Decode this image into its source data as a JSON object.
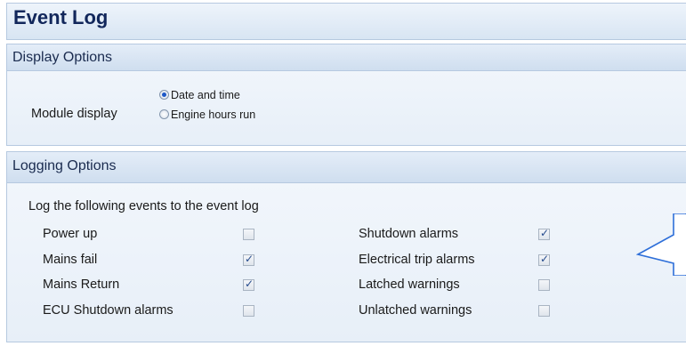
{
  "page_title": "Event Log",
  "display_options": {
    "header": "Display Options",
    "module_display_label": "Module display",
    "options": [
      {
        "label": "Date and time",
        "selected": true
      },
      {
        "label": "Engine hours run",
        "selected": false
      }
    ]
  },
  "logging_options": {
    "header": "Logging Options",
    "intro": "Log the following events to the event log",
    "left_events": [
      {
        "label": "Power up",
        "checked": false
      },
      {
        "label": "Mains fail",
        "checked": true
      },
      {
        "label": "Mains Return",
        "checked": true
      },
      {
        "label": "ECU Shutdown alarms",
        "checked": false
      }
    ],
    "right_events": [
      {
        "label": "Shutdown alarms",
        "checked": true
      },
      {
        "label": "Electrical trip alarms",
        "checked": true
      },
      {
        "label": "Latched warnings",
        "checked": false
      },
      {
        "label": "Unlatched warnings",
        "checked": false
      }
    ]
  },
  "colors": {
    "title_text": "#12275b",
    "panel_border": "#b6c9e0",
    "radio_selected": "#1d58c7",
    "check_mark": "#244a8c"
  }
}
